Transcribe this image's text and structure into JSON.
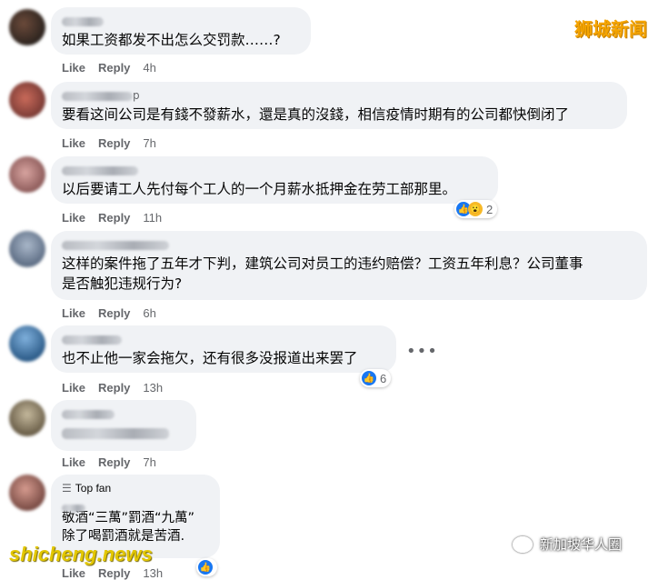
{
  "watermark_top": "狮城新闻",
  "watermark_bottom": "shicheng.news",
  "wechat_mark": "新加坡华人圈",
  "actions": {
    "like": "Like",
    "reply": "Reply"
  },
  "comments": [
    {
      "name_suffix": "",
      "text": "如果工资都发不出怎么交罚款……?",
      "time": "4h"
    },
    {
      "name_suffix": "p",
      "text": "要看这间公司是有錢不發薪水，還是真的沒錢，相信疫情时期有的公司都快倒闭了",
      "time": "7h"
    },
    {
      "name_suffix": "",
      "text": "以后要请工人先付每个工人的一个月薪水抵押金在劳工部那里。",
      "time": "11h",
      "reactions": {
        "count": "2"
      }
    },
    {
      "name_suffix": "",
      "text": "这样的案件拖了五年才下判，建筑公司对员工的违约赔偿？工资五年利息？公司董事\n是否触犯违规行为?",
      "time": "6h"
    },
    {
      "name_suffix": "",
      "text": "也不止他一家会拖欠，还有很多没报道出来罢了",
      "time": "13h",
      "reactions": {
        "count": "6"
      }
    },
    {
      "name_suffix": "",
      "text": "",
      "time": "7h"
    },
    {
      "badge": "Top fan",
      "text": "敬酒“三萬”罰酒“九萬”\n除了喝罰酒就是苦酒.",
      "time": "13h"
    }
  ],
  "colors": {
    "like_blue": "#1877f2",
    "bubble": "#f0f2f5",
    "meta_gray": "#65676b"
  }
}
